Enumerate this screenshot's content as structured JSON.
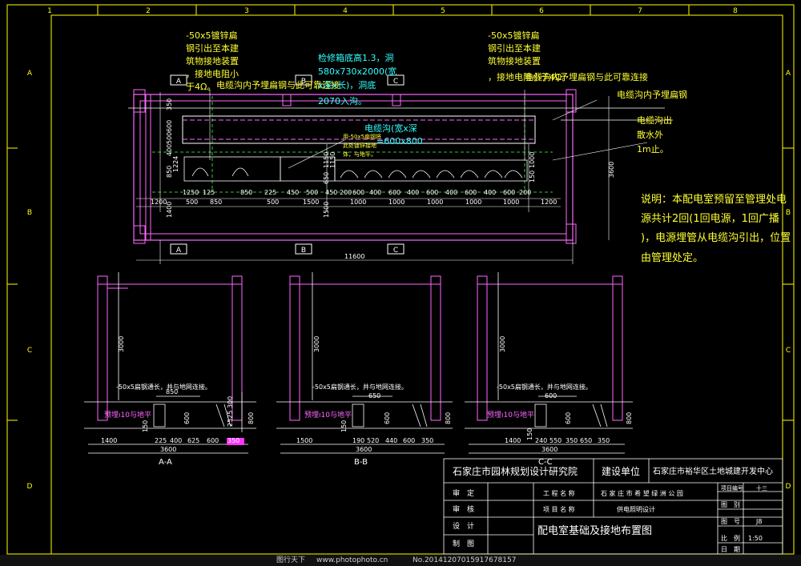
{
  "grid_cols": [
    "1",
    "2",
    "3",
    "4",
    "5",
    "6",
    "7",
    "8"
  ],
  "grid_rows": [
    "A",
    "B",
    "C",
    "D"
  ],
  "notes": {
    "ground_left": [
      "-50x5镀锌扁",
      "钢引出至本建",
      "筑物接地装置",
      "，接地电阻小",
      "于4Ω。"
    ],
    "ground_right": [
      "-50x5镀锌扁",
      "钢引出至本建",
      "筑物接地装置",
      "，接地电阻小于4Ω。"
    ],
    "manhole": [
      "检修箱底高1.3，洞",
      "580x730x2000(宽",
      "x深x长)，洞底",
      "2070入沟。"
    ],
    "trench_steel": "电缆沟内予埋扁钢与此可靠连接",
    "trench_steel_right": "电缆沟内予埋扁钢与此可靠连接",
    "pre_embedded": "电缆沟内予埋扁钢",
    "trench_size": [
      "电缆沟(宽x深",
      "=600x800"
    ],
    "drain": [
      "电缆沟出",
      "散水外",
      "1m止。"
    ],
    "flat_steel_small": [
      "用-50x5扁钢将",
      "此处镀锌接地",
      "体，与地平。"
    ],
    "explanation": [
      "说明：本配电室预留至管理处电",
      "源共计2回(1回电源，1回广播",
      ")，电源埋管从电缆沟引出，位置",
      "由管理处定。"
    ]
  },
  "plan_dims": {
    "top_row": [
      "1250",
      "125",
      "850",
      "225",
      "450",
      "500",
      "450",
      "200",
      "600",
      "400",
      "600",
      "400",
      "600",
      "400",
      "600",
      "400",
      "600",
      "200"
    ],
    "bottom_row": [
      "1200",
      "500",
      "850",
      "500",
      "1500",
      "1000",
      "1000",
      "1000",
      "1000",
      "1000",
      "1200"
    ],
    "total": "11600",
    "left_v": [
      "350",
      "600",
      "500",
      "400",
      "1224",
      "850",
      "1400"
    ],
    "mid_v": [
      "1150",
      "1150",
      "650",
      "1500"
    ],
    "right_v": [
      "1000",
      "150",
      "3600"
    ],
    "axis_labels": [
      "A",
      "B",
      "C"
    ]
  },
  "sections": [
    {
      "title": "A-A",
      "height": "3000",
      "note": "-50x5扁钢通长，并与地网连接。",
      "top_dim": "850",
      "pipe": "预埋ı10与地平",
      "bottom": [
        "1400",
        "225",
        "400",
        "625",
        "600",
        "350"
      ],
      "total": "3600",
      "side": [
        "800",
        "600",
        "2525",
        "300"
      ],
      "v_small": "150"
    },
    {
      "title": "B-B",
      "height": "3000",
      "note": "-50x5扁钢通长，并与地网连接。",
      "top_dim": "650",
      "pipe": "预埋ı10与地平",
      "bottom": [
        "1500",
        "190",
        "520",
        "440",
        "600",
        "350"
      ],
      "total": "3600",
      "side": [
        "800",
        "600"
      ],
      "v_small": "150"
    },
    {
      "title": "C-C",
      "height": "3000",
      "note": "-50x5扁钢通长，并与地网连接。",
      "top_dim": "600",
      "pipe": "预埋ı10与地平",
      "bottom": [
        "1400",
        "240",
        "550",
        "350",
        "650",
        "350"
      ],
      "total": "3600",
      "side": [
        "800",
        "600"
      ],
      "v_small": "150"
    }
  ],
  "title_block": {
    "designer_org": "石家庄市园林规划设计研究院",
    "client_label": "建设单位",
    "client": "石家庄市裕华区土地城建开发中心",
    "row_labels": [
      "审　定",
      "审　核",
      "设　计",
      "制　图"
    ],
    "project_name_label": "工 程 名 称",
    "project_name": "石 家 庄 市 希 望 绿 洲 公 园",
    "item_name_label": "项 目 名 称",
    "item_name": "供电照明设计",
    "drawing_title": "配电室基础及接地布置图",
    "right_labels": [
      "项目编号",
      "图　别",
      "图　号",
      "比　例",
      "日　期"
    ],
    "right_values": [
      "十三",
      "",
      "J8",
      "1:50",
      ""
    ]
  },
  "watermark": {
    "left": "图行天下",
    "url": "www.photophoto.cn",
    "no": "No.20141207015917678157"
  },
  "colors": {
    "frame": "#ffff00",
    "outline": "#ff66ff",
    "note_yellow": "#ffff33",
    "note_cyan": "#33ffff",
    "dim_white": "#ffffff",
    "magenta_fill": "#ff33ff"
  }
}
